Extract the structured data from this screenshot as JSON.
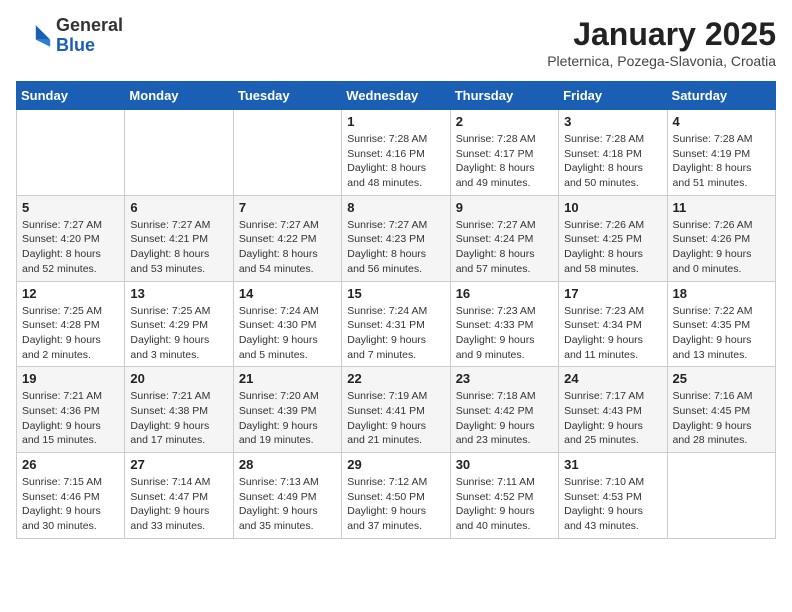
{
  "header": {
    "logo_general": "General",
    "logo_blue": "Blue",
    "month_title": "January 2025",
    "subtitle": "Pleternica, Pozega-Slavonia, Croatia"
  },
  "weekdays": [
    "Sunday",
    "Monday",
    "Tuesday",
    "Wednesday",
    "Thursday",
    "Friday",
    "Saturday"
  ],
  "weeks": [
    [
      {
        "day": "",
        "sunrise": "",
        "sunset": "",
        "daylight": ""
      },
      {
        "day": "",
        "sunrise": "",
        "sunset": "",
        "daylight": ""
      },
      {
        "day": "",
        "sunrise": "",
        "sunset": "",
        "daylight": ""
      },
      {
        "day": "1",
        "sunrise": "Sunrise: 7:28 AM",
        "sunset": "Sunset: 4:16 PM",
        "daylight": "Daylight: 8 hours and 48 minutes."
      },
      {
        "day": "2",
        "sunrise": "Sunrise: 7:28 AM",
        "sunset": "Sunset: 4:17 PM",
        "daylight": "Daylight: 8 hours and 49 minutes."
      },
      {
        "day": "3",
        "sunrise": "Sunrise: 7:28 AM",
        "sunset": "Sunset: 4:18 PM",
        "daylight": "Daylight: 8 hours and 50 minutes."
      },
      {
        "day": "4",
        "sunrise": "Sunrise: 7:28 AM",
        "sunset": "Sunset: 4:19 PM",
        "daylight": "Daylight: 8 hours and 51 minutes."
      }
    ],
    [
      {
        "day": "5",
        "sunrise": "Sunrise: 7:27 AM",
        "sunset": "Sunset: 4:20 PM",
        "daylight": "Daylight: 8 hours and 52 minutes."
      },
      {
        "day": "6",
        "sunrise": "Sunrise: 7:27 AM",
        "sunset": "Sunset: 4:21 PM",
        "daylight": "Daylight: 8 hours and 53 minutes."
      },
      {
        "day": "7",
        "sunrise": "Sunrise: 7:27 AM",
        "sunset": "Sunset: 4:22 PM",
        "daylight": "Daylight: 8 hours and 54 minutes."
      },
      {
        "day": "8",
        "sunrise": "Sunrise: 7:27 AM",
        "sunset": "Sunset: 4:23 PM",
        "daylight": "Daylight: 8 hours and 56 minutes."
      },
      {
        "day": "9",
        "sunrise": "Sunrise: 7:27 AM",
        "sunset": "Sunset: 4:24 PM",
        "daylight": "Daylight: 8 hours and 57 minutes."
      },
      {
        "day": "10",
        "sunrise": "Sunrise: 7:26 AM",
        "sunset": "Sunset: 4:25 PM",
        "daylight": "Daylight: 8 hours and 58 minutes."
      },
      {
        "day": "11",
        "sunrise": "Sunrise: 7:26 AM",
        "sunset": "Sunset: 4:26 PM",
        "daylight": "Daylight: 9 hours and 0 minutes."
      }
    ],
    [
      {
        "day": "12",
        "sunrise": "Sunrise: 7:25 AM",
        "sunset": "Sunset: 4:28 PM",
        "daylight": "Daylight: 9 hours and 2 minutes."
      },
      {
        "day": "13",
        "sunrise": "Sunrise: 7:25 AM",
        "sunset": "Sunset: 4:29 PM",
        "daylight": "Daylight: 9 hours and 3 minutes."
      },
      {
        "day": "14",
        "sunrise": "Sunrise: 7:24 AM",
        "sunset": "Sunset: 4:30 PM",
        "daylight": "Daylight: 9 hours and 5 minutes."
      },
      {
        "day": "15",
        "sunrise": "Sunrise: 7:24 AM",
        "sunset": "Sunset: 4:31 PM",
        "daylight": "Daylight: 9 hours and 7 minutes."
      },
      {
        "day": "16",
        "sunrise": "Sunrise: 7:23 AM",
        "sunset": "Sunset: 4:33 PM",
        "daylight": "Daylight: 9 hours and 9 minutes."
      },
      {
        "day": "17",
        "sunrise": "Sunrise: 7:23 AM",
        "sunset": "Sunset: 4:34 PM",
        "daylight": "Daylight: 9 hours and 11 minutes."
      },
      {
        "day": "18",
        "sunrise": "Sunrise: 7:22 AM",
        "sunset": "Sunset: 4:35 PM",
        "daylight": "Daylight: 9 hours and 13 minutes."
      }
    ],
    [
      {
        "day": "19",
        "sunrise": "Sunrise: 7:21 AM",
        "sunset": "Sunset: 4:36 PM",
        "daylight": "Daylight: 9 hours and 15 minutes."
      },
      {
        "day": "20",
        "sunrise": "Sunrise: 7:21 AM",
        "sunset": "Sunset: 4:38 PM",
        "daylight": "Daylight: 9 hours and 17 minutes."
      },
      {
        "day": "21",
        "sunrise": "Sunrise: 7:20 AM",
        "sunset": "Sunset: 4:39 PM",
        "daylight": "Daylight: 9 hours and 19 minutes."
      },
      {
        "day": "22",
        "sunrise": "Sunrise: 7:19 AM",
        "sunset": "Sunset: 4:41 PM",
        "daylight": "Daylight: 9 hours and 21 minutes."
      },
      {
        "day": "23",
        "sunrise": "Sunrise: 7:18 AM",
        "sunset": "Sunset: 4:42 PM",
        "daylight": "Daylight: 9 hours and 23 minutes."
      },
      {
        "day": "24",
        "sunrise": "Sunrise: 7:17 AM",
        "sunset": "Sunset: 4:43 PM",
        "daylight": "Daylight: 9 hours and 25 minutes."
      },
      {
        "day": "25",
        "sunrise": "Sunrise: 7:16 AM",
        "sunset": "Sunset: 4:45 PM",
        "daylight": "Daylight: 9 hours and 28 minutes."
      }
    ],
    [
      {
        "day": "26",
        "sunrise": "Sunrise: 7:15 AM",
        "sunset": "Sunset: 4:46 PM",
        "daylight": "Daylight: 9 hours and 30 minutes."
      },
      {
        "day": "27",
        "sunrise": "Sunrise: 7:14 AM",
        "sunset": "Sunset: 4:47 PM",
        "daylight": "Daylight: 9 hours and 33 minutes."
      },
      {
        "day": "28",
        "sunrise": "Sunrise: 7:13 AM",
        "sunset": "Sunset: 4:49 PM",
        "daylight": "Daylight: 9 hours and 35 minutes."
      },
      {
        "day": "29",
        "sunrise": "Sunrise: 7:12 AM",
        "sunset": "Sunset: 4:50 PM",
        "daylight": "Daylight: 9 hours and 37 minutes."
      },
      {
        "day": "30",
        "sunrise": "Sunrise: 7:11 AM",
        "sunset": "Sunset: 4:52 PM",
        "daylight": "Daylight: 9 hours and 40 minutes."
      },
      {
        "day": "31",
        "sunrise": "Sunrise: 7:10 AM",
        "sunset": "Sunset: 4:53 PM",
        "daylight": "Daylight: 9 hours and 43 minutes."
      },
      {
        "day": "",
        "sunrise": "",
        "sunset": "",
        "daylight": ""
      }
    ]
  ]
}
